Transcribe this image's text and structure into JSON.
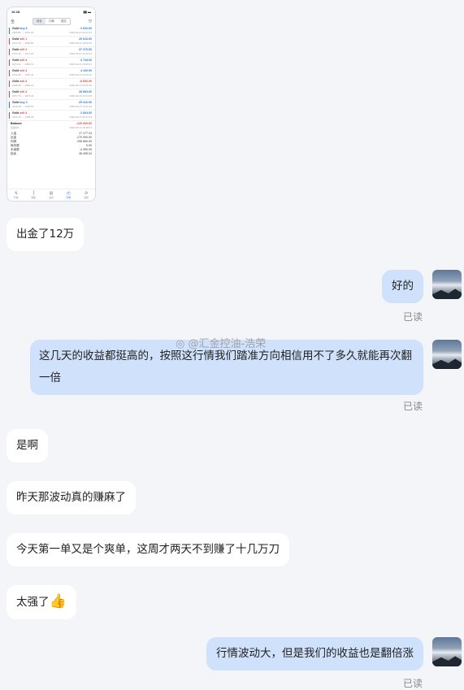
{
  "phone": {
    "time": "16:18",
    "status_icons": "▮▮ ▬",
    "header_left": "全",
    "tabs": [
      "持仓",
      "订单",
      "成交"
    ],
    "trades": [
      {
        "sym": "Gold",
        "side": "buy 6",
        "side_color": "#2a7ae2",
        "profit": "3 632.00",
        "profit_color": "#2a7ae2",
        "price": "1965.82 → 1970.00",
        "time": "2020.03.24 22:23:13"
      },
      {
        "sym": "Gold",
        "side": "sell 1",
        "side_color": "#e0463e",
        "profit": "29 616.00",
        "profit_color": "#2a7ae2",
        "price": "1974.16 → 1966.80",
        "time": "2020.03.24 19:00:34"
      },
      {
        "sym": "Gold",
        "side": "sell 4",
        "side_color": "#e0463e",
        "profit": "37 276.00",
        "profit_color": "#2a7ae2",
        "price": "1973.15 → 1971.30",
        "time": "2020.03.24 15:30:13"
      },
      {
        "sym": "Gold",
        "side": "sell 4",
        "side_color": "#e0463e",
        "profit": "3 744.00",
        "profit_color": "#2a7ae2",
        "price": "1974.11 → 1968.70",
        "time": "2020.03.24 16:00:27"
      },
      {
        "sym": "Gold",
        "side": "sell 4",
        "side_color": "#e0463e",
        "profit": "4 100.00",
        "profit_color": "#2a7ae2",
        "price": "1971.80 → 1961.44",
        "time": "2020.03.24 16:33:12"
      },
      {
        "sym": "Gold",
        "side": "sell 4",
        "side_color": "#e0463e",
        "profit": "-8 600.00",
        "profit_color": "#e0463e",
        "price": "1968.38 → 1981.16",
        "time": "2020.03.24 20:47:40"
      },
      {
        "sym": "Gold",
        "side": "sell 4",
        "side_color": "#e0463e",
        "profit": "28 893.00",
        "profit_color": "#2a7ae2",
        "price": "1977.79 → 1970.02",
        "time": "2020.03.24 21:04:25"
      },
      {
        "sym": "Gold",
        "side": "buy 4",
        "side_color": "#2a7ae2",
        "profit": "25 416.00",
        "profit_color": "#2a7ae2",
        "price": "4328.48 → 4333.20",
        "time": "2020.03.24 14:41:43"
      },
      {
        "sym": "Gold",
        "side": "sell 4",
        "side_color": "#e0463e",
        "profit": "2 664.00",
        "profit_color": "#2a7ae2",
        "price": "4416.16 → 4408.40",
        "time": "2020.03.24 16:37:23"
      }
    ],
    "balance": {
      "label": "Balance",
      "value": "-120 000.00",
      "sub": "出金扣1",
      "time": "2020.03.24 16:18:03"
    },
    "summary": [
      {
        "label": "入金",
        "value": "17 177.24"
      },
      {
        "label": "出金",
        "value": "-170 000.00"
      },
      {
        "label": "利润",
        "value": "206 660.00"
      },
      {
        "label": "库存费",
        "value": "0.00"
      },
      {
        "label": "手续费",
        "value": "-4 350.00"
      },
      {
        "label": "结余",
        "value": "48 495.24"
      }
    ],
    "nav": [
      {
        "icon": "⇅",
        "label": "行情"
      },
      {
        "icon": "⫿",
        "label": "图表"
      },
      {
        "icon": "▤",
        "label": "交易"
      },
      {
        "icon": "◴",
        "label": "历史"
      },
      {
        "icon": "⚙",
        "label": "设置"
      }
    ]
  },
  "messages": [
    {
      "text": "出金了12万"
    },
    {
      "text": "好的",
      "read": "已读"
    },
    {
      "text": "这几天的收益都挺高的，按照这行情我们踏准方向相信用不了多久就能再次翻一倍",
      "read": "已读"
    },
    {
      "text": "是啊"
    },
    {
      "text": "昨天那波动真的赚麻了"
    },
    {
      "text": "今天第一单又是个爽单，这周才两天不到赚了十几万刀"
    },
    {
      "text": "太强了",
      "emoji": "👍"
    },
    {
      "text": "行情波动大，但是我们的收益也是翻倍涨",
      "read": "已读"
    }
  ],
  "watermark": "@汇金控油-浩荣",
  "colors": {
    "page_bg": "#f4f5f9",
    "self_bubble": "#cfe1fb",
    "other_bubble": "#ffffff"
  }
}
